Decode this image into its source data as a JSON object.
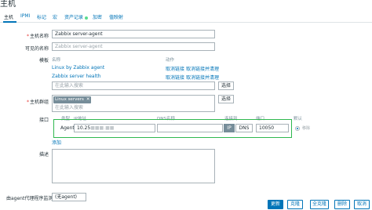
{
  "page": {
    "title": "主机"
  },
  "tabs": [
    {
      "label": "主机"
    },
    {
      "label": "IPMI"
    },
    {
      "label": "标记"
    },
    {
      "label": "宏"
    },
    {
      "label": "资产记录"
    },
    {
      "label": "加密"
    },
    {
      "label": "值映射"
    }
  ],
  "form": {
    "host_name": {
      "label": "主机名称",
      "value": "Zabbix server-agent"
    },
    "visible_name": {
      "label": "可见的名称",
      "placeholder": "Zabbix server-agent"
    },
    "templates": {
      "label": "模板",
      "col_name": "名称",
      "col_action": "动作",
      "rows": [
        {
          "name": "Linux by Zabbix agent",
          "unlink": "取消链接",
          "unlink_clear": "取消链接并清理"
        },
        {
          "name": "Zabbix server health",
          "unlink": "取消链接",
          "unlink_clear": "取消链接并清理"
        }
      ],
      "search_placeholder": "在此输入搜索",
      "select_label": "选择"
    },
    "host_groups": {
      "label": "主机群组",
      "tags": [
        "Linux servers"
      ],
      "search_placeholder": "在此输入搜索",
      "select_label": "选择"
    },
    "interfaces": {
      "label": "接口",
      "headers": {
        "type": "类型",
        "ip": "IP地址",
        "dns": "DNS名称",
        "connect_to": "连接到",
        "port": "端口",
        "default": "默认"
      },
      "row": {
        "type": "Agent",
        "ip": "10.25",
        "ip_masked": "■■■.■■",
        "dns": "",
        "btn_ip": "IP",
        "btn_dns": "DNS",
        "port": "10050",
        "remove": "移除",
        "default_selected": true
      },
      "add_label": "添加"
    },
    "description": {
      "label": "描述"
    },
    "proxy": {
      "label": "由agent代理程序监测",
      "value": "(无agent)"
    }
  },
  "footer": {
    "update": "更新",
    "clone": "克隆",
    "full_clone": "全克隆",
    "delete": "删除",
    "cancel": "取消"
  },
  "colors": {
    "accent": "#0275b8",
    "highlight_border": "#2fb84f",
    "status_dot": "#59db8f",
    "required": "#e33734"
  }
}
